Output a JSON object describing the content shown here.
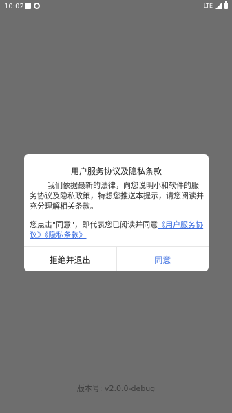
{
  "status_bar": {
    "time": "10:02",
    "network": "LTE",
    "icons": [
      "sd-card-icon",
      "sync-icon",
      "signal-icon",
      "battery-icon"
    ]
  },
  "dialog": {
    "title": "用户服务协议及隐私条款",
    "paragraph1": "我们依据最新的法律，向您说明小和软件的服务协议及隐私政策，特想您推送本提示，请您阅读并充分理解相关条款。",
    "paragraph2_prefix": "您点击\"同意\"，即代表您已阅读并同意",
    "link_service": "《用户服务协议》",
    "link_privacy": "《隐私条款》",
    "reject_label": "拒绝并退出",
    "agree_label": "同意"
  },
  "version": "版本号: v2.0.0-debug",
  "colors": {
    "overlay": "#6e6e6e",
    "link": "#3b6de0",
    "agree": "#3b6de0"
  }
}
